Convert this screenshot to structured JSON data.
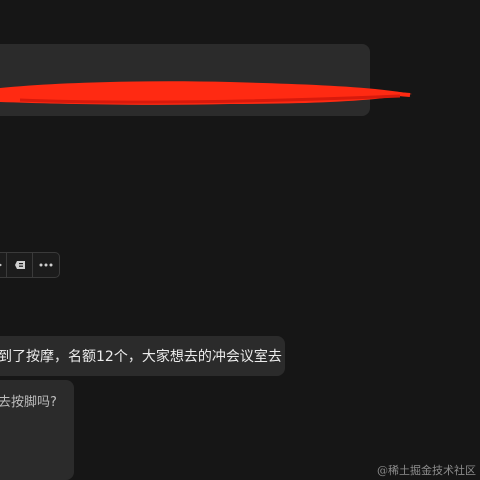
{
  "messages": [
    {
      "text": "",
      "redacted": true
    },
    {
      "text_before": "到了按摩，名额12个，大家想去的冲会议室去",
      "underlined": "",
      "text_after": ""
    },
    {
      "text": "去按脚吗?"
    }
  ],
  "message_actions": [
    {
      "icon": "forward-icon"
    },
    {
      "icon": "quote-icon"
    },
    {
      "icon": "more-icon"
    }
  ],
  "watermark": "@稀土掘金技术社区",
  "colors": {
    "redaction": "#ff2a12",
    "bubble": "#2b2b2b",
    "background": "#161616"
  }
}
